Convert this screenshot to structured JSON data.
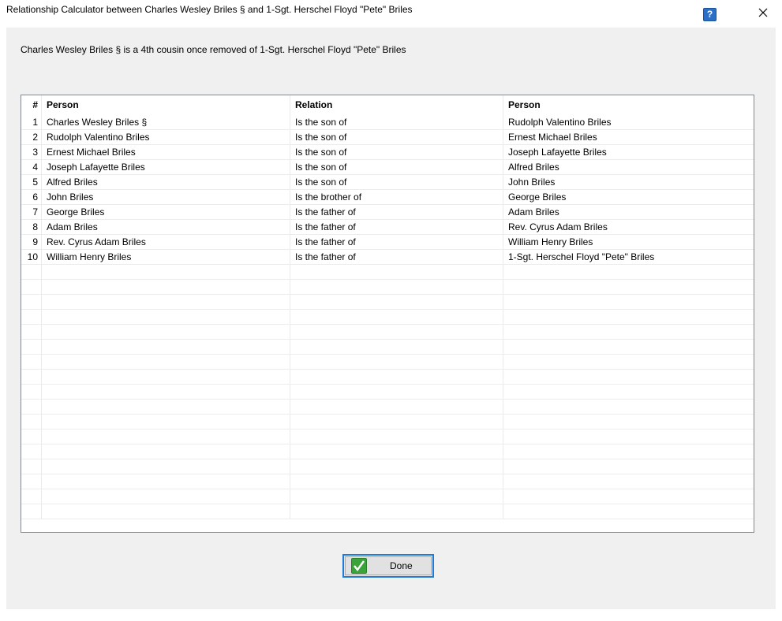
{
  "window": {
    "title": "Relationship Calculator between Charles Wesley Briles § and 1-Sgt. Herschel Floyd \"Pete\" Briles",
    "help_label": "?",
    "close_label": "✕"
  },
  "summary": "Charles Wesley Briles § is a 4th cousin once removed of 1-Sgt. Herschel Floyd \"Pete\" Briles",
  "table": {
    "headers": {
      "num": "#",
      "person1": "Person",
      "relation": "Relation",
      "person2": "Person"
    },
    "rows": [
      {
        "num": "1",
        "person1": "Charles Wesley Briles §",
        "relation": "Is the son of",
        "person2": "Rudolph Valentino Briles"
      },
      {
        "num": "2",
        "person1": "Rudolph Valentino Briles",
        "relation": "Is the son of",
        "person2": "Ernest Michael Briles"
      },
      {
        "num": "3",
        "person1": "Ernest Michael Briles",
        "relation": "Is the son of",
        "person2": "Joseph Lafayette Briles"
      },
      {
        "num": "4",
        "person1": "Joseph Lafayette Briles",
        "relation": "Is the son of",
        "person2": "Alfred Briles"
      },
      {
        "num": "5",
        "person1": "Alfred Briles",
        "relation": "Is the son of",
        "person2": "John Briles"
      },
      {
        "num": "6",
        "person1": "John Briles",
        "relation": "Is the brother of",
        "person2": "George Briles"
      },
      {
        "num": "7",
        "person1": "George Briles",
        "relation": "Is the father of",
        "person2": "Adam Briles"
      },
      {
        "num": "8",
        "person1": "Adam Briles",
        "relation": "Is the father of",
        "person2": "Rev. Cyrus Adam Briles"
      },
      {
        "num": "9",
        "person1": "Rev. Cyrus Adam Briles",
        "relation": "Is the father of",
        "person2": "William Henry Briles"
      },
      {
        "num": "10",
        "person1": "William Henry Briles",
        "relation": "Is the father of",
        "person2": "1-Sgt. Herschel Floyd \"Pete\" Briles"
      }
    ]
  },
  "footer": {
    "done_label": "Done",
    "done_icon": "checkmark-icon"
  },
  "colors": {
    "button_focus_border": "#1f7ad8",
    "help_icon_bg": "#2c6fc7",
    "check_icon_bg": "#3aa33a",
    "client_bg": "#f0f0f0"
  }
}
